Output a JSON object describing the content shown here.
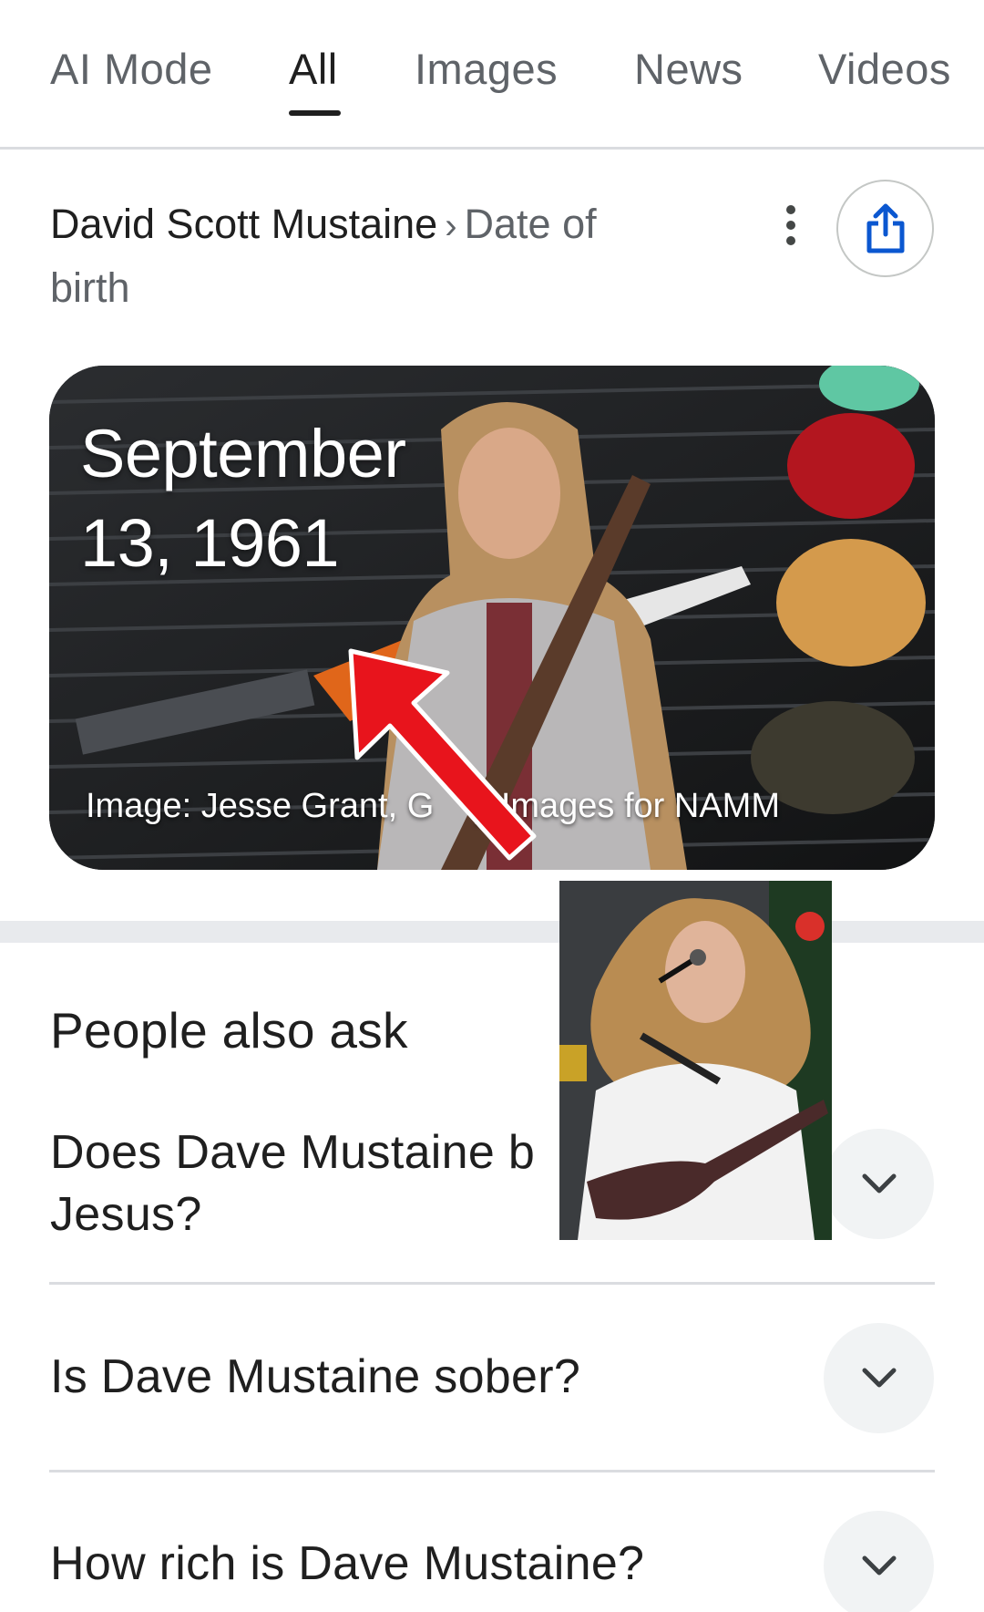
{
  "tabs": [
    {
      "label": "AI Mode",
      "active": false
    },
    {
      "label": "All",
      "active": true
    },
    {
      "label": "Images",
      "active": false
    },
    {
      "label": "News",
      "active": false
    },
    {
      "label": "Videos",
      "active": false
    }
  ],
  "header": {
    "entity": "David Scott Mustaine",
    "separator": "›",
    "attribute_part1": "Date of",
    "attribute_part2": "birth",
    "more_icon": "more-vert-icon",
    "share_icon": "share-icon"
  },
  "hero": {
    "date_line1": "September",
    "date_line2": "13, 1961",
    "credit": "Image: Jesse Grant, G",
    "credit_tail": "y Images for NAMM"
  },
  "people_also_ask": {
    "title": "People also ask",
    "questions": [
      {
        "line1": "Does Dave Mustaine b",
        "line2": "Jesus?"
      },
      {
        "text": "Is Dave Mustaine sober?"
      },
      {
        "text": "How rich is Dave Mustaine?"
      }
    ],
    "chevron_icon": "chevron-down-icon"
  },
  "colors": {
    "text_primary": "#1f1f1f",
    "text_secondary": "#5f6368",
    "accent_blue": "#1a73e8",
    "annotation_red": "#e8141c"
  }
}
